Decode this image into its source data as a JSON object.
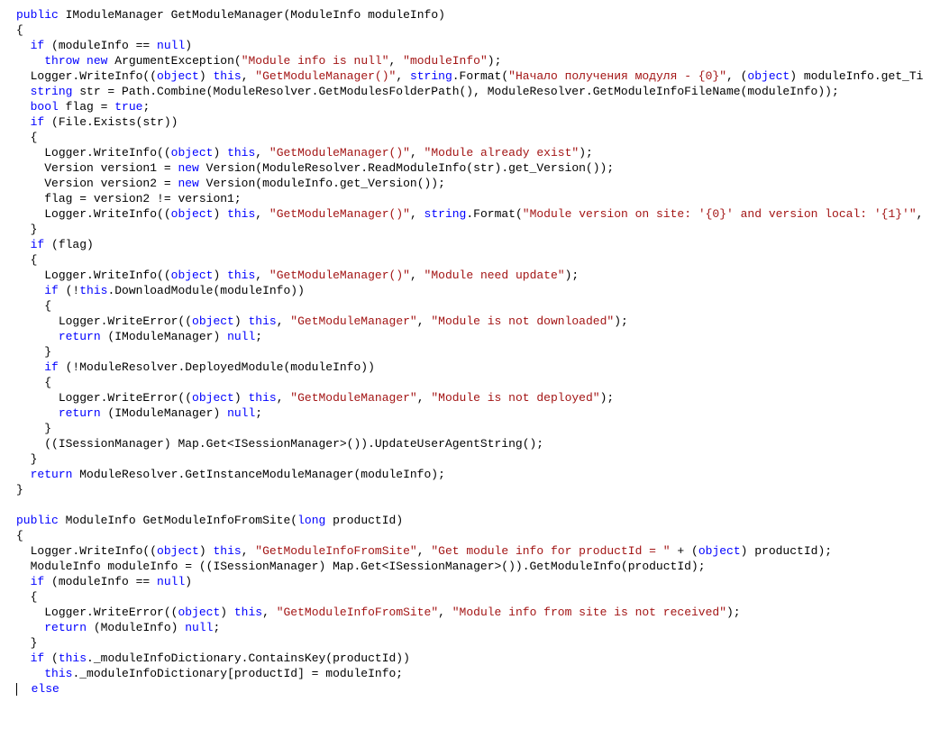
{
  "m1": {
    "sig": {
      "access": "public",
      "ret": "IModuleManager",
      "name": "GetModuleManager",
      "ptype": "ModuleInfo",
      "pname": "moduleInfo"
    },
    "ifNull": {
      "kw_if": "if",
      "chk": " (moduleInfo == ",
      "kw_null": "null",
      "close": ")"
    },
    "throw": {
      "kw_throw": "throw",
      "kw_new": "new",
      "ty": "ArgumentException",
      "s1": "\"Module info is null\"",
      "s2": "\"moduleInfo\""
    },
    "log1": {
      "pre": "Logger.WriteInfo((",
      "kw_obj": "object",
      "post_obj": ") ",
      "kw_this": "this",
      "mid": ", ",
      "s1": "\"GetModuleManager()\"",
      "sep": ", ",
      "kw_str": "string",
      "fmt": ".Format(",
      "s2": "\"Начало получения модуля - {0}\"",
      "sep2": ", (",
      "kw_obj2": "object",
      "tail": ") moduleInfo.get_Ti"
    },
    "strLine": {
      "kw_string": "string",
      "txt": " str = Path.Combine(ModuleResolver.GetModulesFolderPath(), ModuleResolver.GetModuleInfoFileName(moduleInfo));"
    },
    "flagLine": {
      "kw_bool": "bool",
      "txt1": " flag = ",
      "kw_true": "true",
      "txt2": ";"
    },
    "ifExists": {
      "kw_if": "if",
      "txt": " (File.Exists(str))"
    },
    "log2": {
      "pre": "Logger.WriteInfo((",
      "kw_obj": "object",
      "post_obj": ") ",
      "kw_this": "this",
      "sep": ", ",
      "s1": "\"GetModuleManager()\"",
      "s2": "\"Module already exist\"",
      "end": ");"
    },
    "v1": {
      "ty": "Version",
      "txt1": " version1 = ",
      "kw_new": "new",
      "txt2": " Version(ModuleResolver.ReadModuleInfo(str).get_Version());"
    },
    "v2": {
      "ty": "Version",
      "txt1": " version2 = ",
      "kw_new": "new",
      "txt2": " Version(moduleInfo.get_Version());"
    },
    "flagCmp": "flag = version2 != version1;",
    "log3": {
      "pre": "Logger.WriteInfo((",
      "kw_obj": "object",
      "post_obj": ") ",
      "kw_this": "this",
      "sep": ", ",
      "s1": "\"GetModuleManager()\"",
      "sep2": ", ",
      "kw_str": "string",
      "fmt": ".Format(",
      "s2": "\"Module version on site: '{0}' and version local: '{1}'\"",
      "tail": ","
    },
    "ifFlag": {
      "kw_if": "if",
      "txt": " (flag)"
    },
    "log4": {
      "pre": "Logger.WriteInfo((",
      "kw_obj": "object",
      "post_obj": ") ",
      "kw_this": "this",
      "sep": ", ",
      "s1": "\"GetModuleManager()\"",
      "s2": "\"Module need update\"",
      "end": ");"
    },
    "ifDown": {
      "kw_if": "if",
      "txt1": " (!",
      "kw_this": "this",
      "txt2": ".DownloadModule(moduleInfo))"
    },
    "logE1": {
      "pre": "Logger.WriteError((",
      "kw_obj": "object",
      "post_obj": ") ",
      "kw_this": "this",
      "sep": ", ",
      "s1": "\"GetModuleManager\"",
      "s2": "\"Module is not downloaded\"",
      "end": ");"
    },
    "ret1": {
      "kw_return": "return",
      "txt1": " (IModuleManager) ",
      "kw_null": "null",
      "txt2": ";"
    },
    "ifDep": {
      "kw_if": "if",
      "txt": " (!ModuleResolver.DeployedModule(moduleInfo))"
    },
    "logE2": {
      "pre": "Logger.WriteError((",
      "kw_obj": "object",
      "post_obj": ") ",
      "kw_this": "this",
      "sep": ", ",
      "s1": "\"GetModuleManager\"",
      "s2": "\"Module is not deployed\"",
      "end": ");"
    },
    "ret2": {
      "kw_return": "return",
      "txt1": " (IModuleManager) ",
      "kw_null": "null",
      "txt2": ";"
    },
    "sess": "((ISessionManager) Map.Get<ISessionManager>()).UpdateUserAgentString();",
    "retFinal": {
      "kw_return": "return",
      "txt": " ModuleResolver.GetInstanceModuleManager(moduleInfo);"
    }
  },
  "m2": {
    "sig": {
      "access": "public",
      "ret": "ModuleInfo",
      "name": "GetModuleInfoFromSite",
      "ptype": "long",
      "pname": "productId"
    },
    "log1": {
      "pre": "Logger.WriteInfo((",
      "kw_obj": "object",
      "post_obj": ") ",
      "kw_this": "this",
      "sep": ", ",
      "s1": "\"GetModuleInfoFromSite\"",
      "sep2": ", ",
      "s2": "\"Get module info for productId = \"",
      "plus": " + (",
      "kw_obj2": "object",
      "tail": ") productId);"
    },
    "miLine": "ModuleInfo moduleInfo = ((ISessionManager) Map.Get<ISessionManager>()).GetModuleInfo(productId);",
    "ifNull": {
      "kw_if": "if",
      "txt1": " (moduleInfo == ",
      "kw_null": "null",
      "txt2": ")"
    },
    "logE": {
      "pre": "Logger.WriteError((",
      "kw_obj": "object",
      "post_obj": ") ",
      "kw_this": "this",
      "sep": ", ",
      "s1": "\"GetModuleInfoFromSite\"",
      "s2": "\"Module info from site is not received\"",
      "end": ");"
    },
    "ret": {
      "kw_return": "return",
      "txt1": " (ModuleInfo) ",
      "kw_null": "null",
      "txt2": ";"
    },
    "ifDict": {
      "kw_if": "if",
      "txt1": " (",
      "kw_this": "this",
      "txt2": "._moduleInfoDictionary.ContainsKey(productId))"
    },
    "assign": {
      "kw_this": "this",
      "txt": "._moduleInfoDictionary[productId] = moduleInfo;"
    },
    "kw_else": "else"
  },
  "braces": {
    "open": "{",
    "close": "}"
  }
}
